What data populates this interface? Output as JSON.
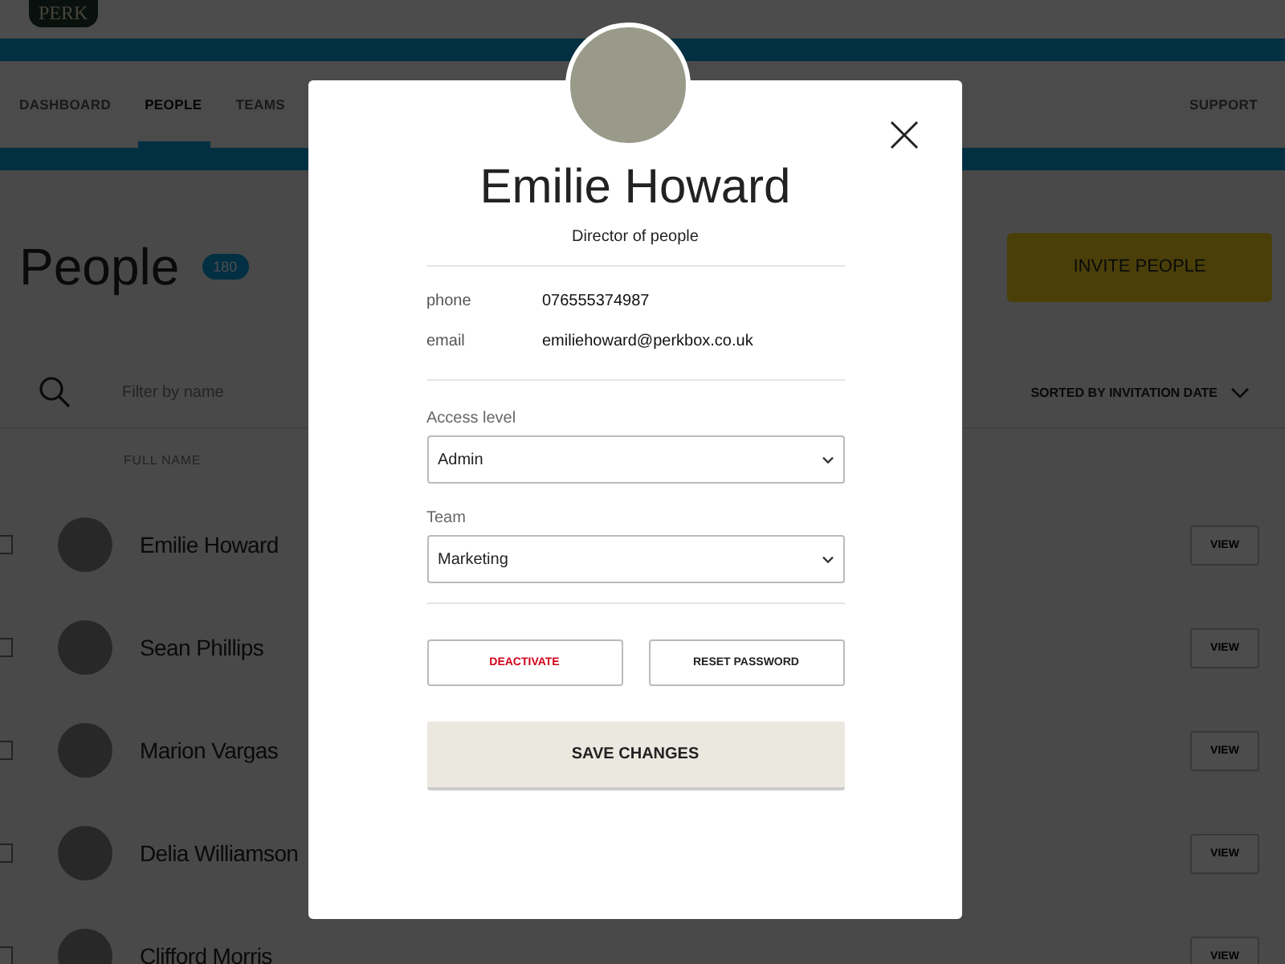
{
  "header": {
    "logo": "PERK"
  },
  "subnav": {
    "items": [
      {
        "label": "DASHBOARD",
        "selected": false
      },
      {
        "label": "PEOPLE",
        "selected": true
      },
      {
        "label": "TEAMS",
        "selected": false
      }
    ],
    "support": "SUPPORT"
  },
  "page": {
    "title": "People",
    "count": "180",
    "invite_button": "INVITE PEOPLE",
    "filter": {
      "placeholder": "Filter by name"
    },
    "sort": "SORTED BY INVITATION DATE",
    "column": "FULL NAME",
    "rows": [
      {
        "name": "Emilie Howard",
        "checked": false,
        "action": "VIEW"
      },
      {
        "name": "Sean Phillips",
        "checked": false,
        "action": "VIEW"
      },
      {
        "name": "Marion Vargas",
        "checked": false,
        "action": "VIEW"
      },
      {
        "name": "Delia Williamson",
        "checked": false,
        "action": "VIEW"
      },
      {
        "name": "Clifford Morris",
        "checked": false,
        "action": "VIEW"
      }
    ]
  },
  "modal": {
    "name": "Emilie Howard",
    "role": "Director of people",
    "details": [
      {
        "label": "phone",
        "value": "076555374987"
      },
      {
        "label": "email",
        "value": "emiliehoward@perkbox.co.uk"
      }
    ],
    "selects": [
      {
        "label": "Access level",
        "value": "Admin"
      },
      {
        "label": "Team",
        "value": "Marketing"
      }
    ],
    "deactivate_button": "DEACTIVATE",
    "reset_button": "RESET PASSWORD",
    "save_button": "SAVE CHANGES"
  }
}
